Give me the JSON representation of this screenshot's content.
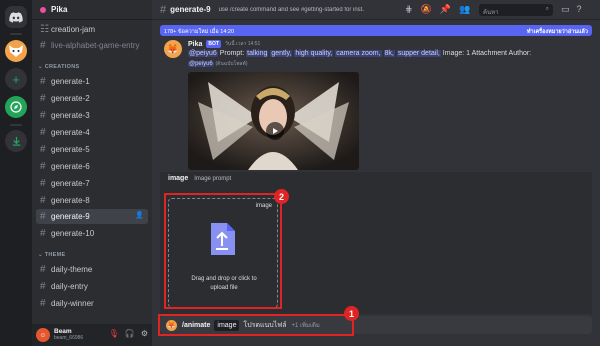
{
  "server": {
    "name": "Pika"
  },
  "sidebar": {
    "top_channels": [
      {
        "label": "creation-jam"
      },
      {
        "label": "live-alphabet-game-entry"
      }
    ],
    "creations_category": "CREATIONS",
    "generate_channels": [
      {
        "label": "generate-1"
      },
      {
        "label": "generate-2"
      },
      {
        "label": "generate-3"
      },
      {
        "label": "generate-4"
      },
      {
        "label": "generate-5"
      },
      {
        "label": "generate-6"
      },
      {
        "label": "generate-7"
      },
      {
        "label": "generate-8"
      },
      {
        "label": "generate-9"
      },
      {
        "label": "generate-10"
      }
    ],
    "theme_category": "THEME",
    "theme_channels": [
      {
        "label": "daily-theme"
      },
      {
        "label": "daily-entry"
      },
      {
        "label": "daily-winner"
      }
    ]
  },
  "user": {
    "name": "Beam",
    "tag": "beam_66986"
  },
  "topbar": {
    "channel": "generate-9",
    "topic": "use /create command and see #getting-started for inst...",
    "search_placeholder": "ค้นหา"
  },
  "new_messages": {
    "left": "178+ ข้อความใหม่ เมื่อ 14:20",
    "right": "ทำเครื่องหมายว่าอ่านแล้ว"
  },
  "message": {
    "author": "Pika",
    "badge": "BOT",
    "timestamp": "วันนี้ เวลา 14:51",
    "mention": "@peiyu6",
    "prompt_label": "Prompt:",
    "prompt_words": [
      "talking",
      "gently,",
      "high quality,",
      "camera zoom,",
      "8k,",
      "supper detail,"
    ],
    "attachment_text": "Image: 1 Attachment  Author:",
    "sub_mention": "@peiyu6",
    "sub_small": "(ต้นฉบับโพสต์)"
  },
  "option": {
    "name": "image",
    "description": "Image prompt"
  },
  "upload": {
    "tag": "image",
    "line1": "Drag and drop or click to",
    "line2": "upload file"
  },
  "command": {
    "name": "/animate",
    "param": "image",
    "placeholder": "โปรดแนบไฟล์",
    "more": "+1 เพิ่มเติม"
  },
  "annotations": {
    "label1": "1",
    "label2": "2"
  },
  "colors": {
    "accent": "#5865f2",
    "annotation": "#e02424",
    "background": "#313338"
  }
}
